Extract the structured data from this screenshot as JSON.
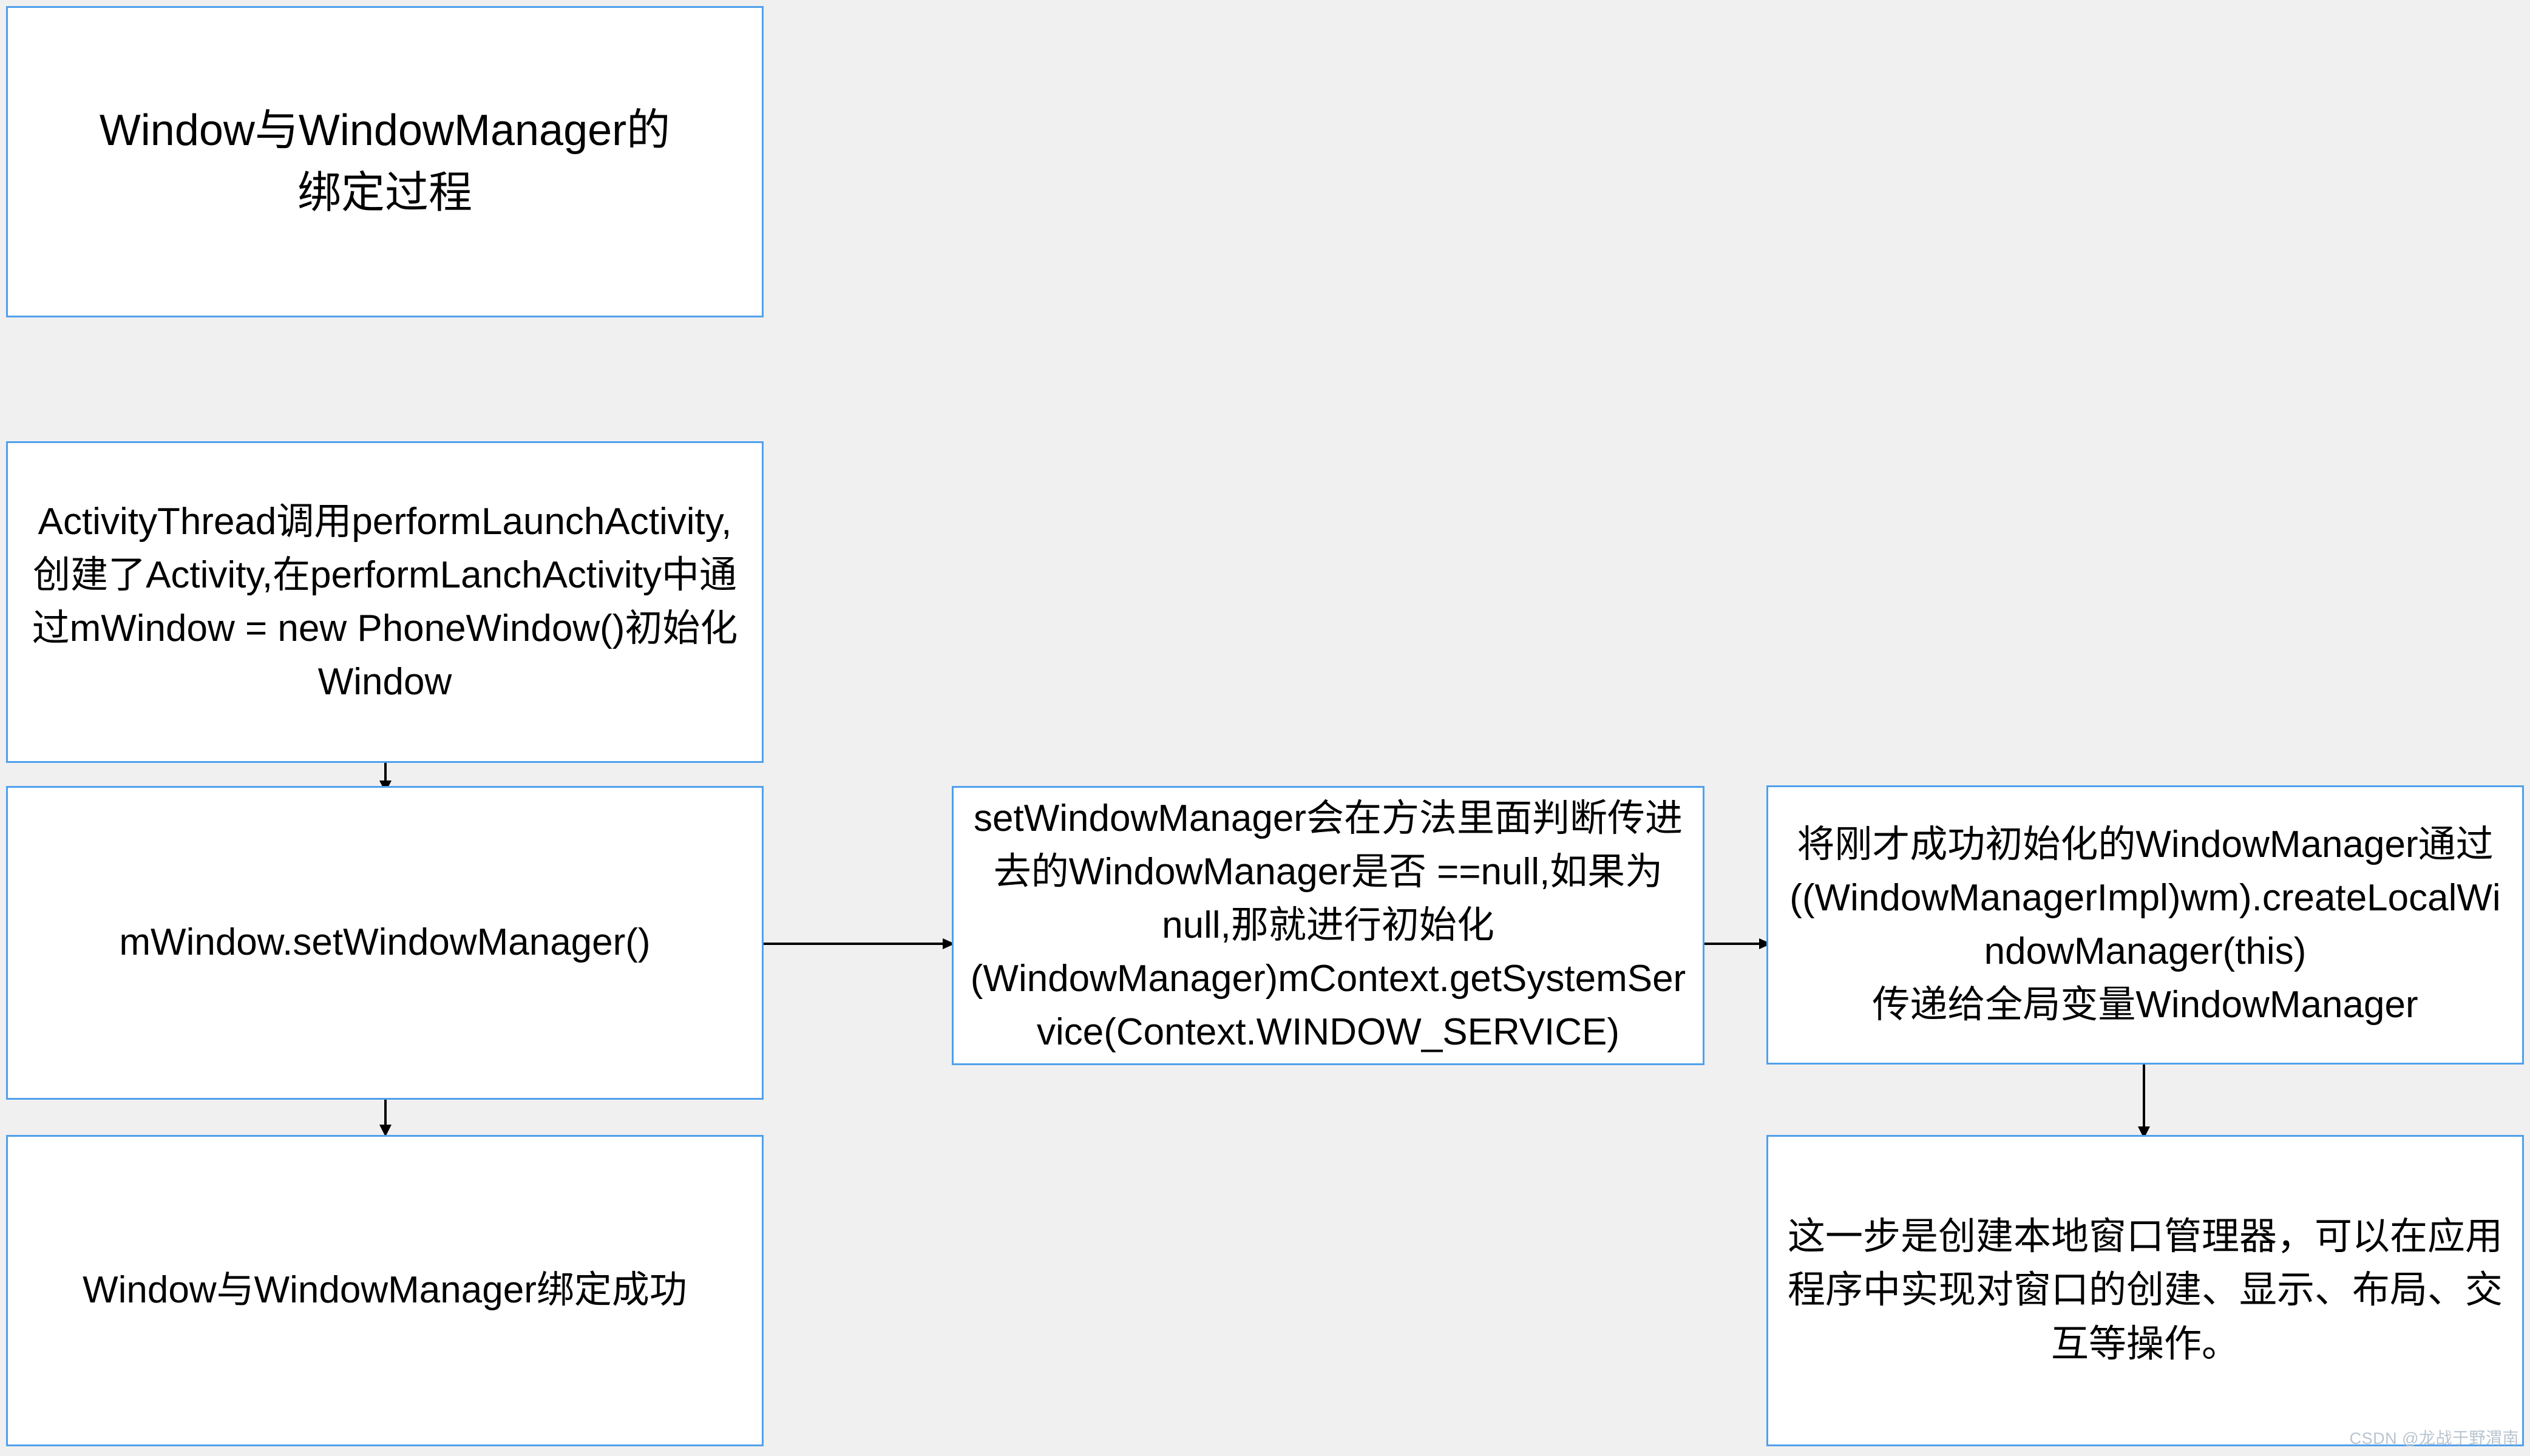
{
  "diagram": {
    "title": "Window与WindowManager的\n绑定过程",
    "background_color": "#f0f0f0",
    "node_fill_color": "#ffffff",
    "node_border_color": "#4fa0ec",
    "connector_color": "#000000",
    "nodes": {
      "title": "Window与WindowManager的\n绑定过程",
      "activity_thread": "ActivityThread调用performLaunchActivity,创建了Activity,在performLanchActivity中通过mWindow = new PhoneWindow()初始化Window",
      "set_window_manager_call": "mWindow.setWindowManager()",
      "bind_success": "Window与WindowManager绑定成功",
      "set_window_manager_detail": "setWindowManager会在方法里面判断传进去的WindowManager是否 ==null,如果为null,那就进行初始化\n(WindowManager)mContext.getSystemService(Context.WINDOW_SERVICE)",
      "create_local_window_manager": "将刚才成功初始化的WindowManager通过((WindowManagerImpl)wm).createLocalWindowManager(this)\n传递给全局变量WindowManager",
      "local_window_manager_note": "这一步是创建本地窗口管理器，可以在应用程序中实现对窗口的创建、显示、布局、交互等操作。"
    },
    "edges": [
      {
        "name": "activity-thread-to-setwm",
        "from": "activity_thread",
        "to": "set_window_manager_call",
        "direction": "down"
      },
      {
        "name": "setwm-to-bind-success",
        "from": "set_window_manager_call",
        "to": "bind_success",
        "direction": "down"
      },
      {
        "name": "setwm-to-detail",
        "from": "set_window_manager_call",
        "to": "set_window_manager_detail",
        "direction": "right"
      },
      {
        "name": "detail-to-createlocal",
        "from": "set_window_manager_detail",
        "to": "create_local_window_manager",
        "direction": "right"
      },
      {
        "name": "createlocal-to-note",
        "from": "create_local_window_manager",
        "to": "local_window_manager_note",
        "direction": "down"
      }
    ]
  },
  "watermark": "CSDN @龙战于野渭南"
}
